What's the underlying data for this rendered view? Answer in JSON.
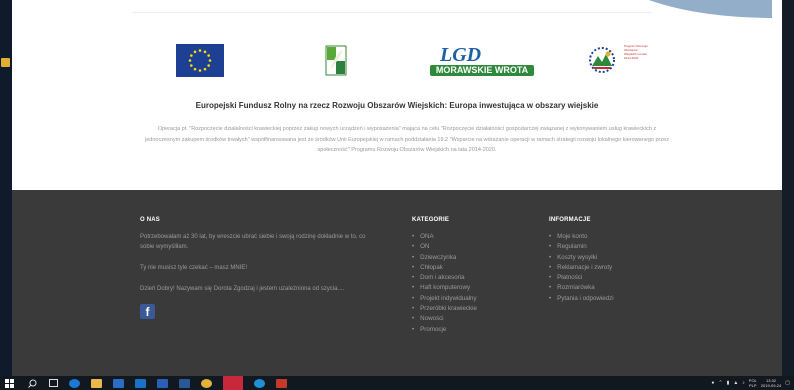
{
  "logos": {
    "lgd_line1": "LGD",
    "lgd_line2": "MORAWSKIE WROTA",
    "prow_text": "Program Rozwoju Obszarów Wiejskich na lata 2014-2020"
  },
  "fund_title": "Europejski Fundusz Rolny na rzecz Rozwoju Obszarów Wiejskich: Europa inwestująca w obszary wiejskie",
  "operation_text": "Operacja pt. \"Rozpoczęcie działalności krawieckiej poprzez zakup nowych urządzeń i wyposażenia\" mająca na celu \"Rozpoczęcie działalności gospodarczej związanej z wykonywaniem usług krawieckich z jednoczesnym zakupem środków trwałych\" współfinansowana jest ze środków Unii Europejskiej w ramach poddziałania 19.2 \"Wsparcie na wdrażanie operacji w ramach strategii rozwoju lokalnego kierowanego przez społeczność\" Programu Rozwoju Obszarów Wiejskich na lata 2014-2020.",
  "footer": {
    "about": {
      "title": "O NAS",
      "p1": "Potrzebowałam aż 30 lat, by wreszcie ubrać siebie i swoją rodzinę dokładnie w to, co sobie wymyśliłam.",
      "p2": "Ty nie musisz tyle czekać – masz MNIE!",
      "p3": "Dzień Dobry! Nazywam się Dorota Zgodzaj i jestem uzależniona od szycia...."
    },
    "categories": {
      "title": "KATEGORIE",
      "items": [
        "ONA",
        "ON",
        "Dziewczynka",
        "Chłopak",
        "Dom i akcesoria",
        "Haft komputerowy",
        "Projekt indywidualny",
        "Przeróbki krawieckie",
        "Nowości",
        "Promocje"
      ]
    },
    "info": {
      "title": "INFORMACJE",
      "items": [
        "Moje konto",
        "Regulamin",
        "Koszty wysyłki",
        "Reklamacje i zwroty",
        "Płatności",
        "Rozmiarówka",
        "Pytania i odpowiedzi"
      ]
    }
  },
  "taskbar": {
    "lang1": "POL",
    "lang2": "PLP",
    "time": "13:32",
    "date": "2019-09-24"
  }
}
